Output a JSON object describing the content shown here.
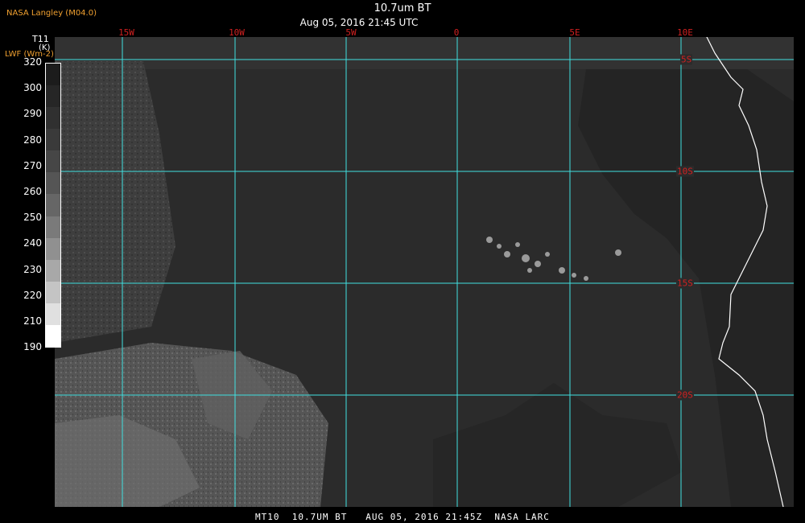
{
  "header": {
    "agency": "NASA Langley (M04.0)",
    "title": "10.7um BT",
    "subtitle": "Aug 05, 2016 21:45 UTC"
  },
  "legend": {
    "title_line1": "T11",
    "title_line2": "(K)",
    "title_line3": "LWF (Wm-2)",
    "ticks": [
      "320",
      "300",
      "290",
      "280",
      "270",
      "260",
      "250",
      "240",
      "230",
      "220",
      "210",
      "190"
    ],
    "ramp": [
      "#1c1c1c",
      "#262626",
      "#303030",
      "#3a3a3a",
      "#464646",
      "#555555",
      "#666666",
      "#7a7a7a",
      "#909090",
      "#a8a8a8",
      "#c4c4c4",
      "#e0e0e0",
      "#ffffff"
    ]
  },
  "map": {
    "lon_labels": [
      "15W",
      "10W",
      "5W",
      "0",
      "5E",
      "10E"
    ],
    "lat_labels": [
      "5S",
      "10S",
      "15S",
      "20S"
    ],
    "grid_color": "#40e0e0",
    "label_color": "#d02020",
    "coast_color": "#ffffff",
    "background_color": "#2b2b2b"
  },
  "footer": {
    "text": "MT10  10.7UM BT   AUG 05, 2016 21:45Z  NASA LARC"
  }
}
